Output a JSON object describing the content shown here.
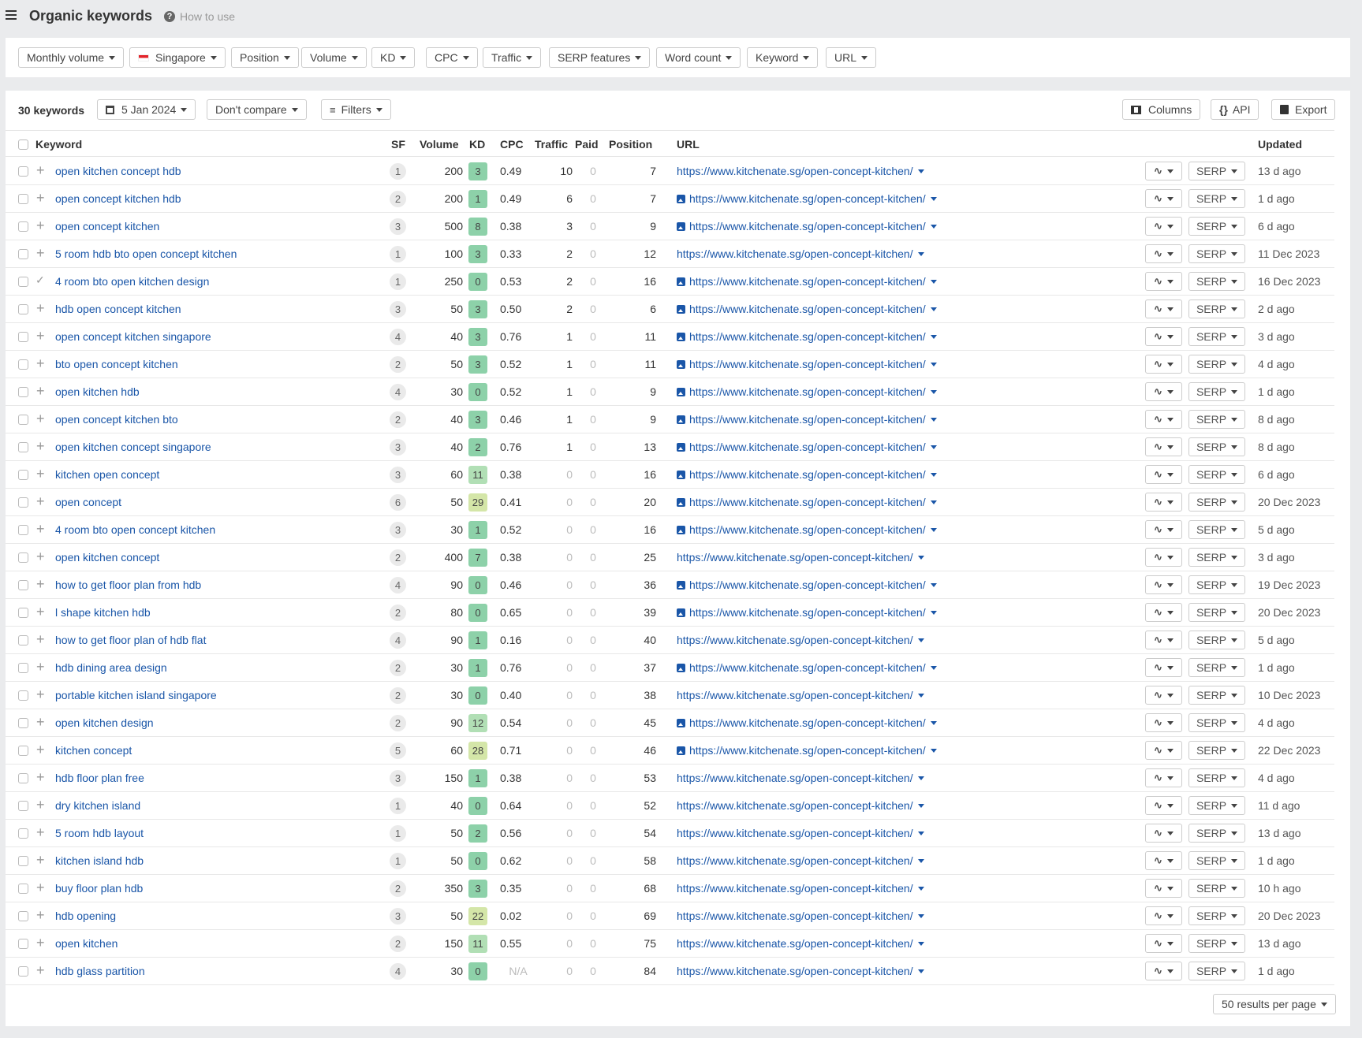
{
  "header": {
    "title": "Organic keywords",
    "how_to_use": "How to use",
    "menu_icon": "hamburger-icon",
    "help_icon": "question-icon"
  },
  "filters": [
    "Monthly volume",
    "Singapore",
    "Position",
    "Volume",
    "KD",
    "CPC",
    "Traffic",
    "SERP features",
    "Word count",
    "Keyword",
    "URL"
  ],
  "toolbar": {
    "count": "30 keywords",
    "date": "5 Jan 2024",
    "compare": "Don't compare",
    "filters": "Filters",
    "columns": "Columns",
    "api": "API",
    "export": "Export"
  },
  "columns": {
    "keyword": "Keyword",
    "sf": "SF",
    "volume": "Volume",
    "kd": "KD",
    "cpc": "CPC",
    "traffic": "Traffic",
    "paid": "Paid",
    "position": "Position",
    "url": "URL",
    "updated": "Updated"
  },
  "serp_label": "SERP",
  "kd_colors": {
    "low": "#8dd1a9",
    "mid": "#b1dfb5",
    "high": "#d4e6a8"
  },
  "rows": [
    {
      "keyword": "open kitchen concept hdb",
      "sf": "1",
      "volume": "200",
      "kd": "3",
      "cpc": "0.49",
      "traffic": "10",
      "paid": "0",
      "position": "7",
      "url": "https://www.kitchenate.sg/open-concept-kitchen/",
      "img": false,
      "updated": "13 d ago",
      "added": false
    },
    {
      "keyword": "open concept kitchen hdb",
      "sf": "2",
      "volume": "200",
      "kd": "1",
      "cpc": "0.49",
      "traffic": "6",
      "paid": "0",
      "position": "7",
      "url": "https://www.kitchenate.sg/open-concept-kitchen/",
      "img": true,
      "updated": "1 d ago",
      "added": false
    },
    {
      "keyword": "open concept kitchen",
      "sf": "3",
      "volume": "500",
      "kd": "8",
      "cpc": "0.38",
      "traffic": "3",
      "paid": "0",
      "position": "9",
      "url": "https://www.kitchenate.sg/open-concept-kitchen/",
      "img": true,
      "updated": "6 d ago",
      "added": false
    },
    {
      "keyword": "5 room hdb bto open concept kitchen",
      "sf": "1",
      "volume": "100",
      "kd": "3",
      "cpc": "0.33",
      "traffic": "2",
      "paid": "0",
      "position": "12",
      "url": "https://www.kitchenate.sg/open-concept-kitchen/",
      "img": false,
      "updated": "11 Dec 2023",
      "added": false
    },
    {
      "keyword": "4 room bto open kitchen design",
      "sf": "1",
      "volume": "250",
      "kd": "0",
      "cpc": "0.53",
      "traffic": "2",
      "paid": "0",
      "position": "16",
      "url": "https://www.kitchenate.sg/open-concept-kitchen/",
      "img": true,
      "updated": "16 Dec 2023",
      "added": true
    },
    {
      "keyword": "hdb open concept kitchen",
      "sf": "3",
      "volume": "50",
      "kd": "3",
      "cpc": "0.50",
      "traffic": "2",
      "paid": "0",
      "position": "6",
      "url": "https://www.kitchenate.sg/open-concept-kitchen/",
      "img": true,
      "updated": "2 d ago",
      "added": false
    },
    {
      "keyword": "open concept kitchen singapore",
      "sf": "4",
      "volume": "40",
      "kd": "3",
      "cpc": "0.76",
      "traffic": "1",
      "paid": "0",
      "position": "11",
      "url": "https://www.kitchenate.sg/open-concept-kitchen/",
      "img": true,
      "updated": "3 d ago",
      "added": false
    },
    {
      "keyword": "bto open concept kitchen",
      "sf": "2",
      "volume": "50",
      "kd": "3",
      "cpc": "0.52",
      "traffic": "1",
      "paid": "0",
      "position": "11",
      "url": "https://www.kitchenate.sg/open-concept-kitchen/",
      "img": true,
      "updated": "4 d ago",
      "added": false
    },
    {
      "keyword": "open kitchen hdb",
      "sf": "4",
      "volume": "30",
      "kd": "0",
      "cpc": "0.52",
      "traffic": "1",
      "paid": "0",
      "position": "9",
      "url": "https://www.kitchenate.sg/open-concept-kitchen/",
      "img": true,
      "updated": "1 d ago",
      "added": false
    },
    {
      "keyword": "open concept kitchen bto",
      "sf": "2",
      "volume": "40",
      "kd": "3",
      "cpc": "0.46",
      "traffic": "1",
      "paid": "0",
      "position": "9",
      "url": "https://www.kitchenate.sg/open-concept-kitchen/",
      "img": true,
      "updated": "8 d ago",
      "added": false
    },
    {
      "keyword": "open kitchen concept singapore",
      "sf": "3",
      "volume": "40",
      "kd": "2",
      "cpc": "0.76",
      "traffic": "1",
      "paid": "0",
      "position": "13",
      "url": "https://www.kitchenate.sg/open-concept-kitchen/",
      "img": true,
      "updated": "8 d ago",
      "added": false
    },
    {
      "keyword": "kitchen open concept",
      "sf": "3",
      "volume": "60",
      "kd": "11",
      "cpc": "0.38",
      "traffic": "0",
      "paid": "0",
      "position": "16",
      "url": "https://www.kitchenate.sg/open-concept-kitchen/",
      "img": true,
      "updated": "6 d ago",
      "added": false
    },
    {
      "keyword": "open concept",
      "sf": "6",
      "volume": "50",
      "kd": "29",
      "cpc": "0.41",
      "traffic": "0",
      "paid": "0",
      "position": "20",
      "url": "https://www.kitchenate.sg/open-concept-kitchen/",
      "img": true,
      "updated": "20 Dec 2023",
      "added": false
    },
    {
      "keyword": "4 room bto open concept kitchen",
      "sf": "3",
      "volume": "30",
      "kd": "1",
      "cpc": "0.52",
      "traffic": "0",
      "paid": "0",
      "position": "16",
      "url": "https://www.kitchenate.sg/open-concept-kitchen/",
      "img": true,
      "updated": "5 d ago",
      "added": false
    },
    {
      "keyword": "open kitchen concept",
      "sf": "2",
      "volume": "400",
      "kd": "7",
      "cpc": "0.38",
      "traffic": "0",
      "paid": "0",
      "position": "25",
      "url": "https://www.kitchenate.sg/open-concept-kitchen/",
      "img": false,
      "updated": "3 d ago",
      "added": false
    },
    {
      "keyword": "how to get floor plan from hdb",
      "sf": "4",
      "volume": "90",
      "kd": "0",
      "cpc": "0.46",
      "traffic": "0",
      "paid": "0",
      "position": "36",
      "url": "https://www.kitchenate.sg/open-concept-kitchen/",
      "img": true,
      "updated": "19 Dec 2023",
      "added": false
    },
    {
      "keyword": "l shape kitchen hdb",
      "sf": "2",
      "volume": "80",
      "kd": "0",
      "cpc": "0.65",
      "traffic": "0",
      "paid": "0",
      "position": "39",
      "url": "https://www.kitchenate.sg/open-concept-kitchen/",
      "img": true,
      "updated": "20 Dec 2023",
      "added": false
    },
    {
      "keyword": "how to get floor plan of hdb flat",
      "sf": "4",
      "volume": "90",
      "kd": "1",
      "cpc": "0.16",
      "traffic": "0",
      "paid": "0",
      "position": "40",
      "url": "https://www.kitchenate.sg/open-concept-kitchen/",
      "img": false,
      "updated": "5 d ago",
      "added": false
    },
    {
      "keyword": "hdb dining area design",
      "sf": "2",
      "volume": "30",
      "kd": "1",
      "cpc": "0.76",
      "traffic": "0",
      "paid": "0",
      "position": "37",
      "url": "https://www.kitchenate.sg/open-concept-kitchen/",
      "img": true,
      "updated": "1 d ago",
      "added": false
    },
    {
      "keyword": "portable kitchen island singapore",
      "sf": "2",
      "volume": "30",
      "kd": "0",
      "cpc": "0.40",
      "traffic": "0",
      "paid": "0",
      "position": "38",
      "url": "https://www.kitchenate.sg/open-concept-kitchen/",
      "img": false,
      "updated": "10 Dec 2023",
      "added": false
    },
    {
      "keyword": "open kitchen design",
      "sf": "2",
      "volume": "90",
      "kd": "12",
      "cpc": "0.54",
      "traffic": "0",
      "paid": "0",
      "position": "45",
      "url": "https://www.kitchenate.sg/open-concept-kitchen/",
      "img": true,
      "updated": "4 d ago",
      "added": false
    },
    {
      "keyword": "kitchen concept",
      "sf": "5",
      "volume": "60",
      "kd": "28",
      "cpc": "0.71",
      "traffic": "0",
      "paid": "0",
      "position": "46",
      "url": "https://www.kitchenate.sg/open-concept-kitchen/",
      "img": true,
      "updated": "22 Dec 2023",
      "added": false
    },
    {
      "keyword": "hdb floor plan free",
      "sf": "3",
      "volume": "150",
      "kd": "1",
      "cpc": "0.38",
      "traffic": "0",
      "paid": "0",
      "position": "53",
      "url": "https://www.kitchenate.sg/open-concept-kitchen/",
      "img": false,
      "updated": "4 d ago",
      "added": false
    },
    {
      "keyword": "dry kitchen island",
      "sf": "1",
      "volume": "40",
      "kd": "0",
      "cpc": "0.64",
      "traffic": "0",
      "paid": "0",
      "position": "52",
      "url": "https://www.kitchenate.sg/open-concept-kitchen/",
      "img": false,
      "updated": "11 d ago",
      "added": false
    },
    {
      "keyword": "5 room hdb layout",
      "sf": "1",
      "volume": "50",
      "kd": "2",
      "cpc": "0.56",
      "traffic": "0",
      "paid": "0",
      "position": "54",
      "url": "https://www.kitchenate.sg/open-concept-kitchen/",
      "img": false,
      "updated": "13 d ago",
      "added": false
    },
    {
      "keyword": "kitchen island hdb",
      "sf": "1",
      "volume": "50",
      "kd": "0",
      "cpc": "0.62",
      "traffic": "0",
      "paid": "0",
      "position": "58",
      "url": "https://www.kitchenate.sg/open-concept-kitchen/",
      "img": false,
      "updated": "1 d ago",
      "added": false
    },
    {
      "keyword": "buy floor plan hdb",
      "sf": "2",
      "volume": "350",
      "kd": "3",
      "cpc": "0.35",
      "traffic": "0",
      "paid": "0",
      "position": "68",
      "url": "https://www.kitchenate.sg/open-concept-kitchen/",
      "img": false,
      "updated": "10 h ago",
      "added": false
    },
    {
      "keyword": "hdb opening",
      "sf": "3",
      "volume": "50",
      "kd": "22",
      "cpc": "0.02",
      "traffic": "0",
      "paid": "0",
      "position": "69",
      "url": "https://www.kitchenate.sg/open-concept-kitchen/",
      "img": false,
      "updated": "20 Dec 2023",
      "added": false
    },
    {
      "keyword": "open kitchen",
      "sf": "2",
      "volume": "150",
      "kd": "11",
      "cpc": "0.55",
      "traffic": "0",
      "paid": "0",
      "position": "75",
      "url": "https://www.kitchenate.sg/open-concept-kitchen/",
      "img": false,
      "updated": "13 d ago",
      "added": false
    },
    {
      "keyword": "hdb glass partition",
      "sf": "4",
      "volume": "30",
      "kd": "0",
      "cpc": "N/A",
      "traffic": "0",
      "paid": "0",
      "position": "84",
      "url": "https://www.kitchenate.sg/open-concept-kitchen/",
      "img": false,
      "updated": "1 d ago",
      "added": false
    }
  ],
  "footer": {
    "per_page": "50 results per page"
  }
}
